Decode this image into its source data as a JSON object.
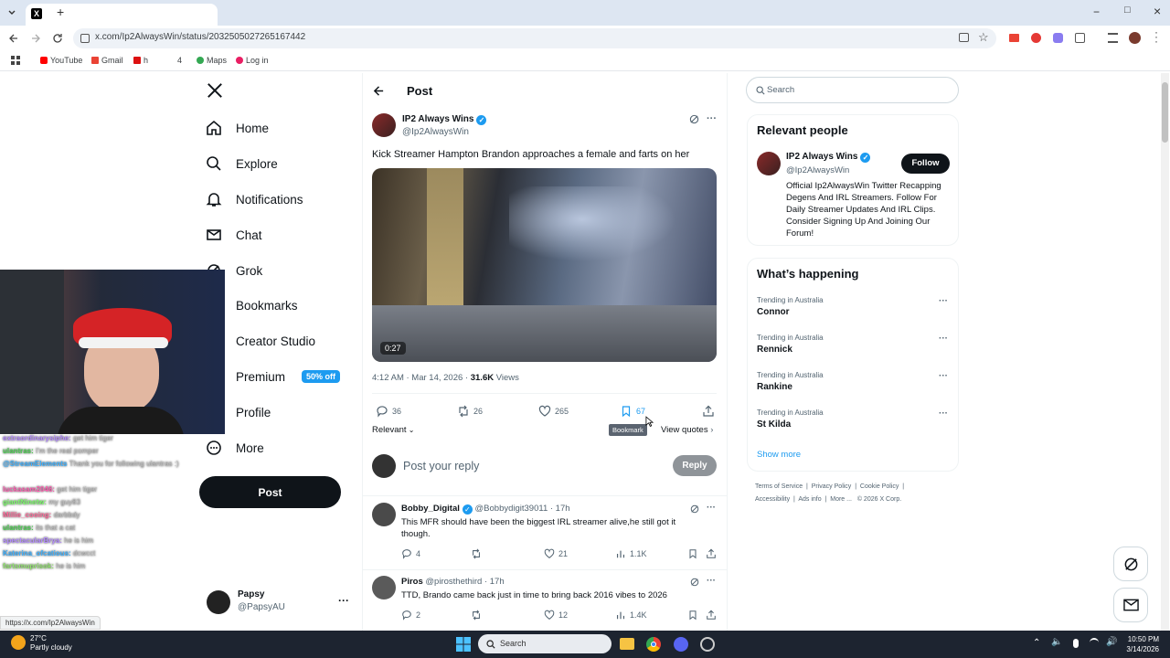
{
  "browser": {
    "tab_close": "×",
    "new_tab": "+",
    "url": "x.com/Ip2AlwaysWin/status/2032505027265167442",
    "bookmarks": [
      "YouTube",
      "Gmail",
      "h",
      "4",
      "Maps",
      "Log in"
    ],
    "minimize": "−",
    "maximize": "□",
    "close": "×"
  },
  "nav": {
    "items": [
      "Home",
      "Explore",
      "Notifications",
      "Chat",
      "Grok",
      "Bookmarks",
      "Creator Studio",
      "Premium",
      "Profile",
      "More"
    ],
    "premium_badge": "50% off",
    "post_label": "Post",
    "account_name": "Papsy",
    "account_handle": "@PapsyAU",
    "account_more": "···"
  },
  "header": {
    "title": "Post"
  },
  "post": {
    "author": "IP2 Always Wins",
    "handle": "@Ip2AlwaysWin",
    "text": "Kick Streamer Hampton Brandon approaches a female and farts on her",
    "video_duration": "0:27",
    "time": "4:12 AM · Mar 14, 2026 · ",
    "views_count": "31.6K",
    "views_label": "Views",
    "replies": "36",
    "reposts": "26",
    "likes": "265",
    "bookmarks": "67",
    "tooltip": "Bookmark",
    "sort_label": "Relevant",
    "view_quotes": "View quotes",
    "more": "···"
  },
  "composer": {
    "placeholder": "Post your reply",
    "button": "Reply"
  },
  "replies": [
    {
      "name": "Bobby_Digital",
      "handle": "@Bobbydigit39011 · 17h",
      "text": "This MFR should have been the biggest IRL streamer alive,he still got it though.",
      "replies": "4",
      "reposts": "",
      "likes": "21",
      "views": "1.1K"
    },
    {
      "name": "Piros",
      "handle": "@pirosthethird · 17h",
      "text": "TTD, Brando came back just in time to bring back 2016 vibes to 2026",
      "replies": "2",
      "reposts": "",
      "likes": "12",
      "views": "1.4K"
    }
  ],
  "search": {
    "placeholder": "Search"
  },
  "relevant_people": {
    "title": "Relevant people",
    "name": "IP2 Always Wins",
    "handle": "@Ip2AlwaysWin",
    "follow": "Follow",
    "bio": "Official Ip2AlwaysWin Twitter Recapping Degens And IRL Streamers. Follow For Daily Streamer Updates And IRL Clips. Consider Signing Up And Joining Our Forum!"
  },
  "happening": {
    "title": "What’s happening",
    "trends": [
      {
        "meta": "Trending in Australia",
        "name": "Connor"
      },
      {
        "meta": "Trending in Australia",
        "name": "Rennick"
      },
      {
        "meta": "Trending in Australia",
        "name": "Rankine"
      },
      {
        "meta": "Trending in Australia",
        "name": "St Kilda"
      }
    ],
    "show_more": "Show more",
    "more": "···"
  },
  "footer": {
    "line1": [
      "Terms of Service",
      "Privacy Policy",
      "Cookie Policy"
    ],
    "line2": [
      "Accessibility",
      "Ads info",
      "More ...",
      "© 2026 X Corp."
    ]
  },
  "status_link": "https://x.com/Ip2AlwaysWin",
  "chat": [
    {
      "user": "extraordinarysiphe:",
      "msg": "get him tiger",
      "color": "#b48bff"
    },
    {
      "user": "ulantras:",
      "msg": "I'm the real pomper",
      "color": "#49d14f"
    },
    {
      "user": "@StreamElements",
      "msg": "Thank you for following ulantras :)",
      "color": "#3db1ff"
    },
    {
      "user": "luckasam2046:",
      "msg": "get him tiger",
      "color": "#ff5db1"
    },
    {
      "user": "giantNinetw:",
      "msg": "my guy83",
      "color": "#7cff6b"
    },
    {
      "user": "Millie_cooing:",
      "msg": "darbbdy",
      "color": "#ff6b9a"
    },
    {
      "user": "ulantras:",
      "msg": "its that a cat",
      "color": "#49d14f"
    },
    {
      "user": "spectacularBrya:",
      "msg": "he is him",
      "color": "#b48bff"
    },
    {
      "user": "Katerina_ofcatious:",
      "msg": "dcwcct",
      "color": "#3db1ff"
    },
    {
      "user": "fartsmuprisok:",
      "msg": "he is him",
      "color": "#8fe36b"
    }
  ],
  "taskbar": {
    "weather_temp": "27°C",
    "weather_desc": "Partly cloudy",
    "search": "Search",
    "time": "10:50 PM",
    "date": "3/14/2026"
  },
  "colors": {
    "accent": "#1d9bf0",
    "text": "#0f1419",
    "muted": "#536471"
  }
}
